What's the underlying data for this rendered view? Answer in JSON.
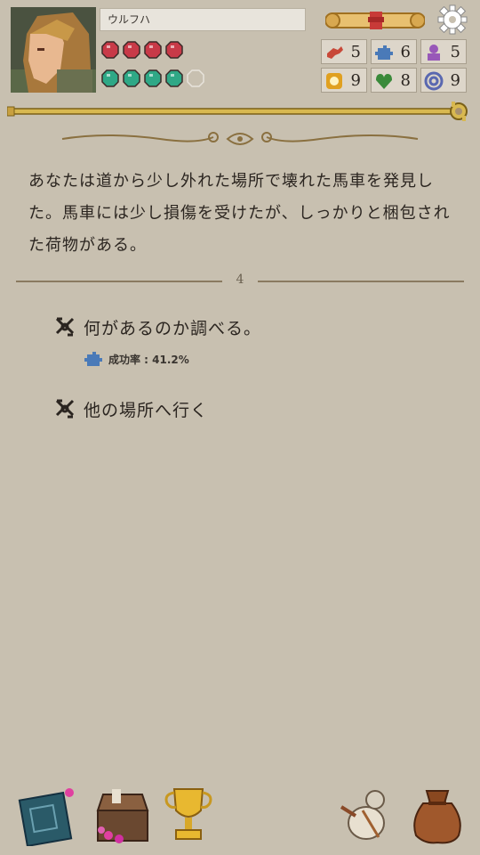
{
  "player": {
    "name": "ウルフハ"
  },
  "stats": [
    {
      "icon": "red-arm-icon",
      "value": "5",
      "color": "#c84838"
    },
    {
      "icon": "blue-puzzle-icon",
      "value": "6",
      "color": "#4a7ab8"
    },
    {
      "icon": "purple-figure-icon",
      "value": "5",
      "color": "#9858b8"
    },
    {
      "icon": "gold-coin-icon",
      "value": "9",
      "color": "#e0a020"
    },
    {
      "icon": "green-heart-icon",
      "value": "8",
      "color": "#3a8a3a"
    },
    {
      "icon": "blue-rings-icon",
      "value": "9",
      "color": "#5a68b0"
    }
  ],
  "health": {
    "filled": 4,
    "max": 4,
    "color": "#c83a48"
  },
  "spirit": {
    "filled": 4,
    "max": 5,
    "color": "#2fa886"
  },
  "story": {
    "text": "あなたは道から少し外れた場所で壊れた馬車を発見した。馬車には少し損傷を受けたが、しっかりと梱包された荷物がある。",
    "page": "4"
  },
  "choices": [
    {
      "label": "何があるのか調べる。",
      "rate_label": "成功率 : 41.2%"
    },
    {
      "label": "他の場所へ行く"
    }
  ]
}
